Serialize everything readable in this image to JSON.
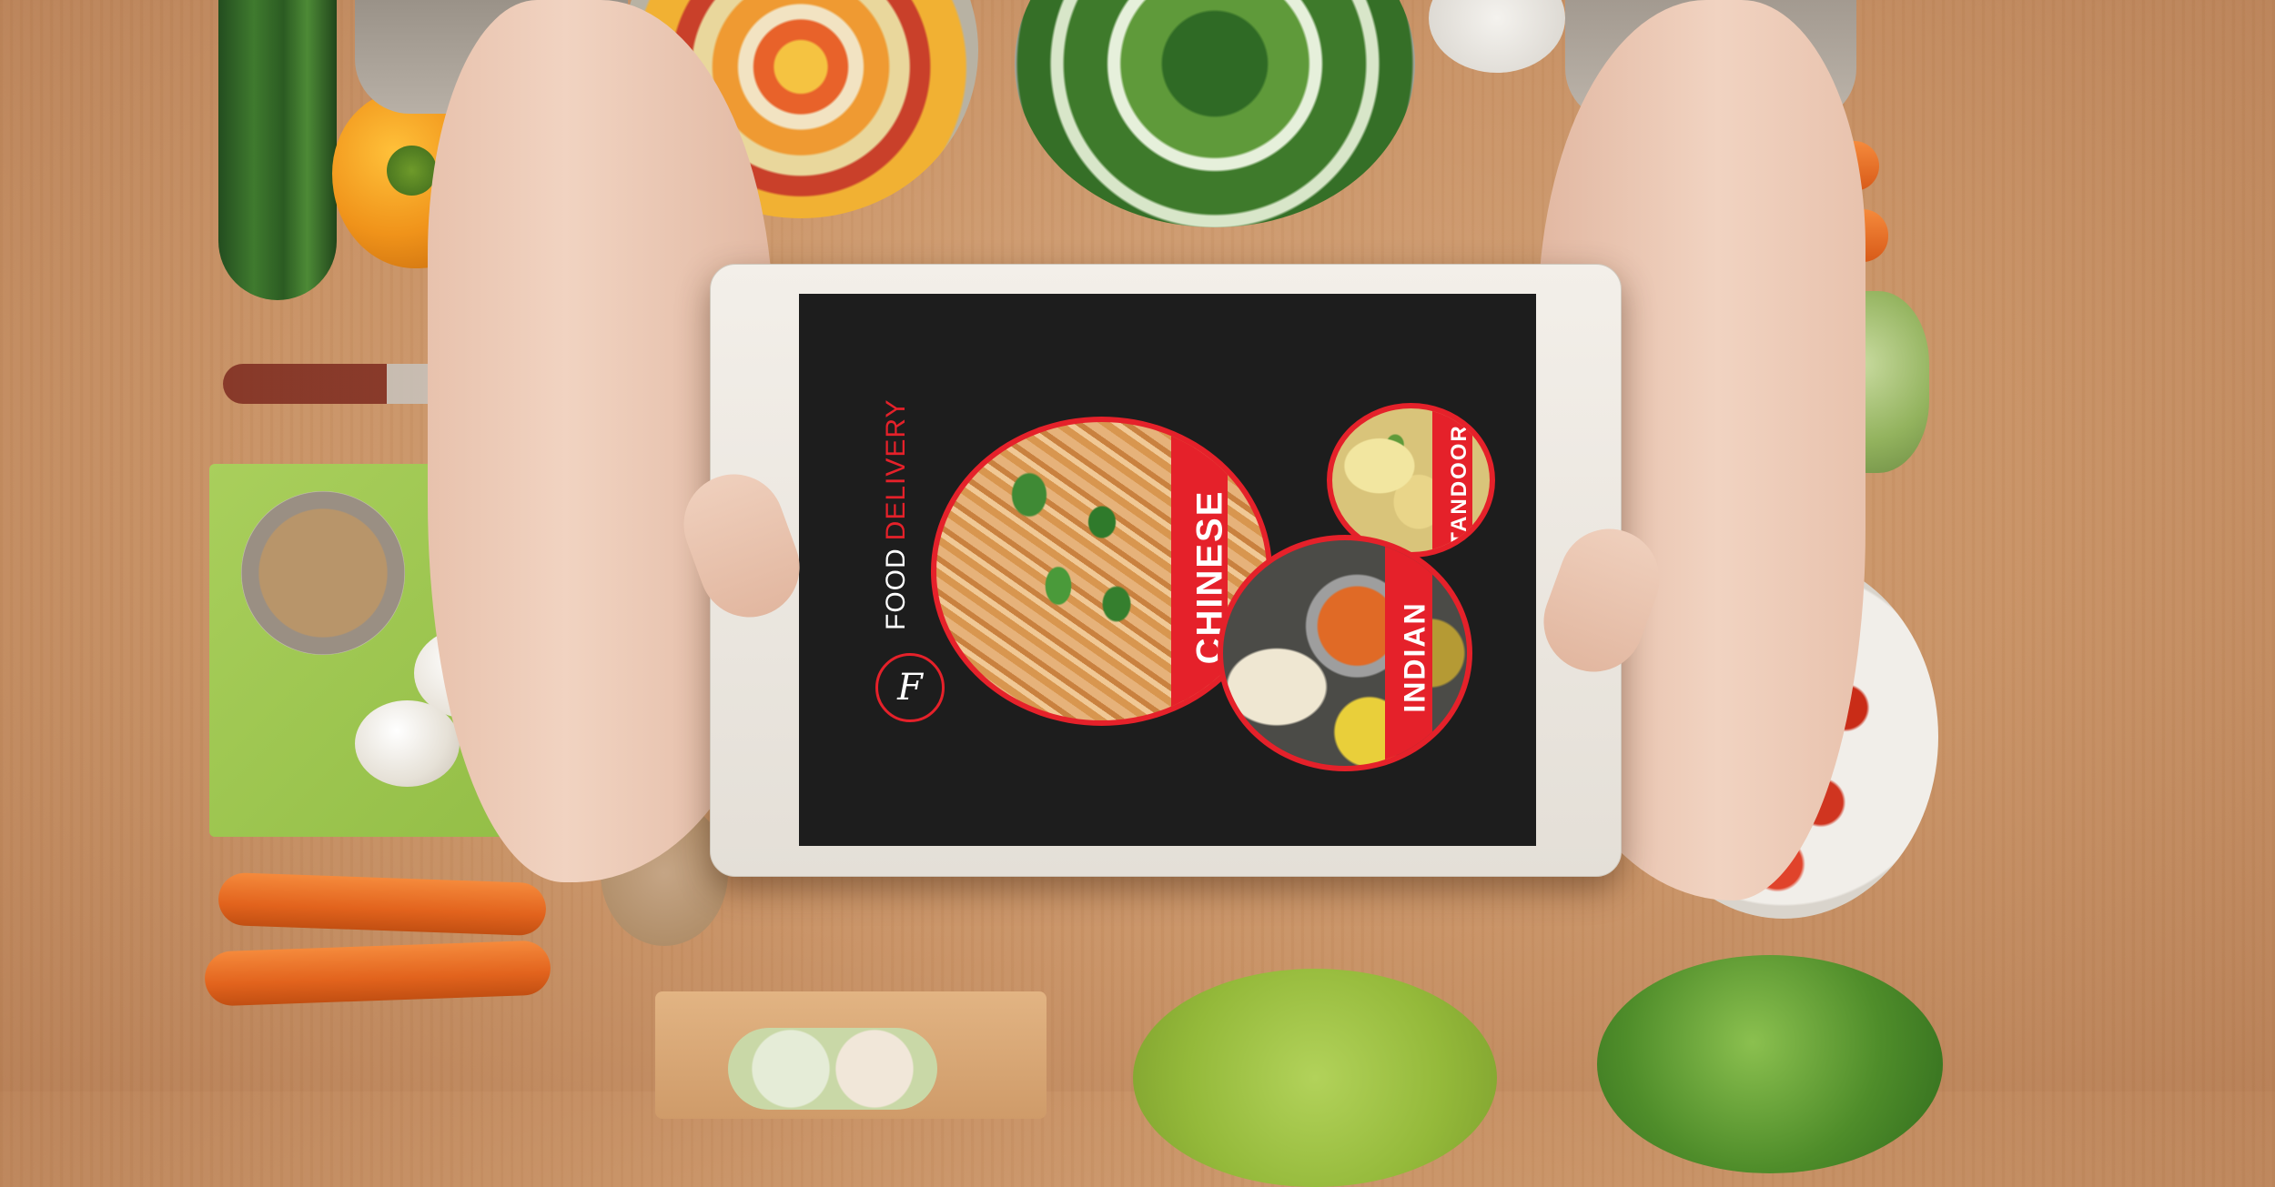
{
  "brand": {
    "word1": "FOOD",
    "word2": "DELIVERY",
    "logo_letter": "F",
    "accent_color": "#e5212a",
    "screen_color": "#1d1d1d"
  },
  "categories": [
    {
      "id": "chinese",
      "label": "CHINESE"
    },
    {
      "id": "tandoor",
      "label": "TANDOOR"
    },
    {
      "id": "indian",
      "label": "INDIAN"
    }
  ],
  "icons": {
    "logo": "letter-f-circle-logo-icon"
  }
}
